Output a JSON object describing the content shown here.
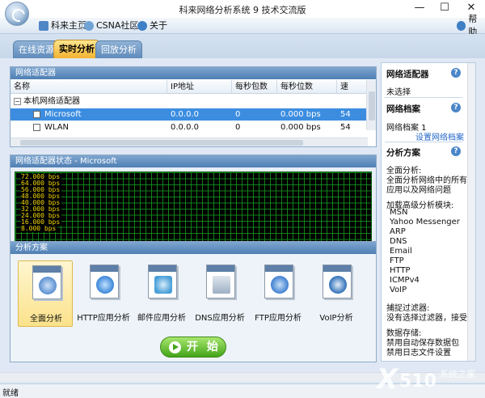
{
  "window": {
    "title": "科来网络分析系统 9 技术交流版",
    "minimize_glyph": "—",
    "maximize_glyph": "☐",
    "close_glyph": "✕"
  },
  "toolbar": {
    "home_label": "科来主页",
    "community_label": "CSNA社区",
    "about_label": "关于",
    "help_label": "帮助",
    "icons": [
      "home-icon",
      "community-icon",
      "info-icon",
      "help-icon"
    ]
  },
  "tabs": [
    {
      "label": "在线资源",
      "active": false
    },
    {
      "label": "实时分析",
      "active": true
    },
    {
      "label": "回放分析",
      "active": false
    }
  ],
  "adapters_panel": {
    "title": "网络适配器",
    "columns": [
      "名称",
      "IP地址",
      "每秒包数",
      "每秒位数",
      "速"
    ],
    "group_label": "本机网络适配器",
    "rows": [
      {
        "name": "Microsoft",
        "ip": "0.0.0.0",
        "pps": "0",
        "bps": "0.000 bps",
        "speed": "54",
        "selected": true
      },
      {
        "name": "WLAN",
        "ip": "0.0.0.0",
        "pps": "0",
        "bps": "0.000 bps",
        "speed": "54",
        "selected": false
      }
    ]
  },
  "status_panel": {
    "title": "网络适配器状态 - Microsoft",
    "y_ticks": [
      "72.000 bps",
      "64.000 bps",
      "56.000 bps",
      "48.000 bps",
      "40.000 bps",
      "32.000 bps",
      "24.000 bps",
      "16.000 bps",
      "8.000 bps"
    ]
  },
  "scheme_panel": {
    "title": "分析方案",
    "schemes": [
      {
        "label": "全面分析",
        "selected": true,
        "icon": "magnifier-icon",
        "color": "#5a8fd0"
      },
      {
        "label": "HTTP应用分析",
        "selected": false,
        "icon": "globe-icon",
        "color": "#3b86d8"
      },
      {
        "label": "邮件应用分析",
        "selected": false,
        "icon": "mail-icon",
        "color": "#4aa0d8"
      },
      {
        "label": "DNS应用分析",
        "selected": false,
        "icon": "dns-icon",
        "color": "#4e9d4a"
      },
      {
        "label": "FTP应用分析",
        "selected": false,
        "icon": "ftp-icon",
        "color": "#3f7fd0"
      },
      {
        "label": "VoIP分析",
        "selected": false,
        "icon": "headset-icon",
        "color": "#2f6fb8"
      }
    ],
    "start_label": "开 始"
  },
  "side": {
    "adapter_title": "网络适配器",
    "adapter_value": "未选择",
    "profile_title": "网络档案",
    "profile_value": "网络档案 1",
    "profile_link": "设置网络档案",
    "scheme_title": "分析方案",
    "scheme_lines": [
      "全面分析:",
      "全面分析网络中的所有",
      "应用以及网络问题",
      "",
      "加载高级分析模块:",
      "MSN",
      "Yahoo Messenger",
      "ARP",
      "DNS",
      "Email",
      "FTP",
      "HTTP",
      "ICMPv4",
      "VoIP",
      "",
      "捕捉过滤器:",
      "没有选择过滤器，接受",
      "",
      "数据存储:",
      "禁用自动保存数据包",
      "禁用日志文件设置"
    ]
  },
  "status_bar": {
    "text": "就绪"
  },
  "watermark": {
    "text": "X 510 系统之家"
  },
  "colors": {
    "accent_tab": "#f3b32f",
    "selection": "#3c8de0",
    "graph_grid": "#149620",
    "graph_labels": "#f2d800",
    "start_button": "#43a419",
    "link": "#2367c7"
  }
}
